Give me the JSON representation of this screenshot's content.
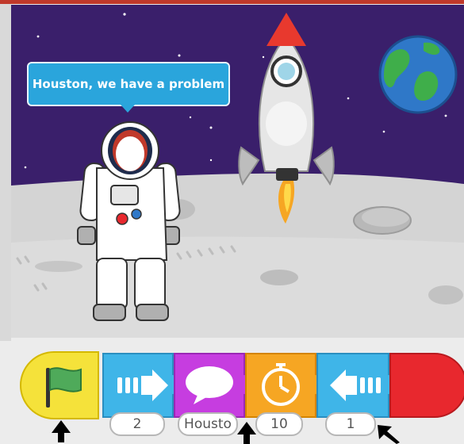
{
  "stage": {
    "speech_bubble_text": "Houston, we have a problem"
  },
  "script": {
    "blocks": [
      {
        "name": "green-flag-trigger-block",
        "icon": "green-flag-icon",
        "color": "#f5e23a"
      },
      {
        "name": "move-right-block",
        "icon": "arrow-right-icon",
        "color": "#3fb5e8",
        "param": "2"
      },
      {
        "name": "say-block",
        "icon": "speech-bubble-icon",
        "color": "#c63de0",
        "param": "Housto"
      },
      {
        "name": "wait-block",
        "icon": "stopwatch-icon",
        "color": "#f6a623",
        "param": "10"
      },
      {
        "name": "move-left-block",
        "icon": "arrow-left-icon",
        "color": "#3fb5e8",
        "param": "1"
      },
      {
        "name": "end-block",
        "icon": "",
        "color": "#e8282e"
      }
    ]
  },
  "colors": {
    "sky": "#3a1f6b",
    "moon": "#d9d9d9",
    "rocket_nose": "#e8392e",
    "bubble": "#2aa5dc"
  }
}
